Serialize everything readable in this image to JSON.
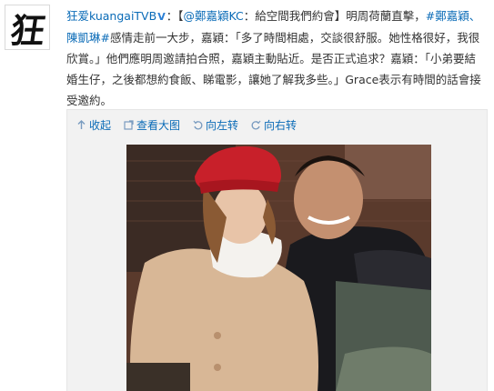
{
  "avatar": {
    "glyph": "狂"
  },
  "post": {
    "author": "狂爱kuangaiTVB",
    "verify_mark": "V",
    "segments": [
      {
        "text": "：【",
        "link": false
      },
      {
        "text": "@鄭嘉穎KC",
        "link": true
      },
      {
        "text": "：給空間我們約會】明周荷蘭直擊，",
        "link": false
      },
      {
        "text": "#鄭嘉穎、陳凱琳#",
        "link": true
      },
      {
        "text": "感情走前一大步，嘉穎：「多了時間相處，交談很舒服。她性格很好，我很欣賞。」他們應明周邀請拍合照，嘉穎主動貼近。是否正式追求？嘉穎：「小弟要結婚生仔，之後都想約食飯、睇電影，讓她了解我多些。」Grace表示有時間的話會接受邀約。",
        "link": false
      }
    ]
  },
  "media": {
    "toolbar": {
      "collapse": "收起",
      "view_large": "查看大图",
      "rotate_left": "向左转",
      "rotate_right": "向右转"
    },
    "photo_subject": "couple-photo"
  },
  "colors": {
    "link": "#0a6bb7",
    "text": "#333333",
    "media_bg": "#f2f2f2",
    "verify": "#2a7ed4"
  }
}
